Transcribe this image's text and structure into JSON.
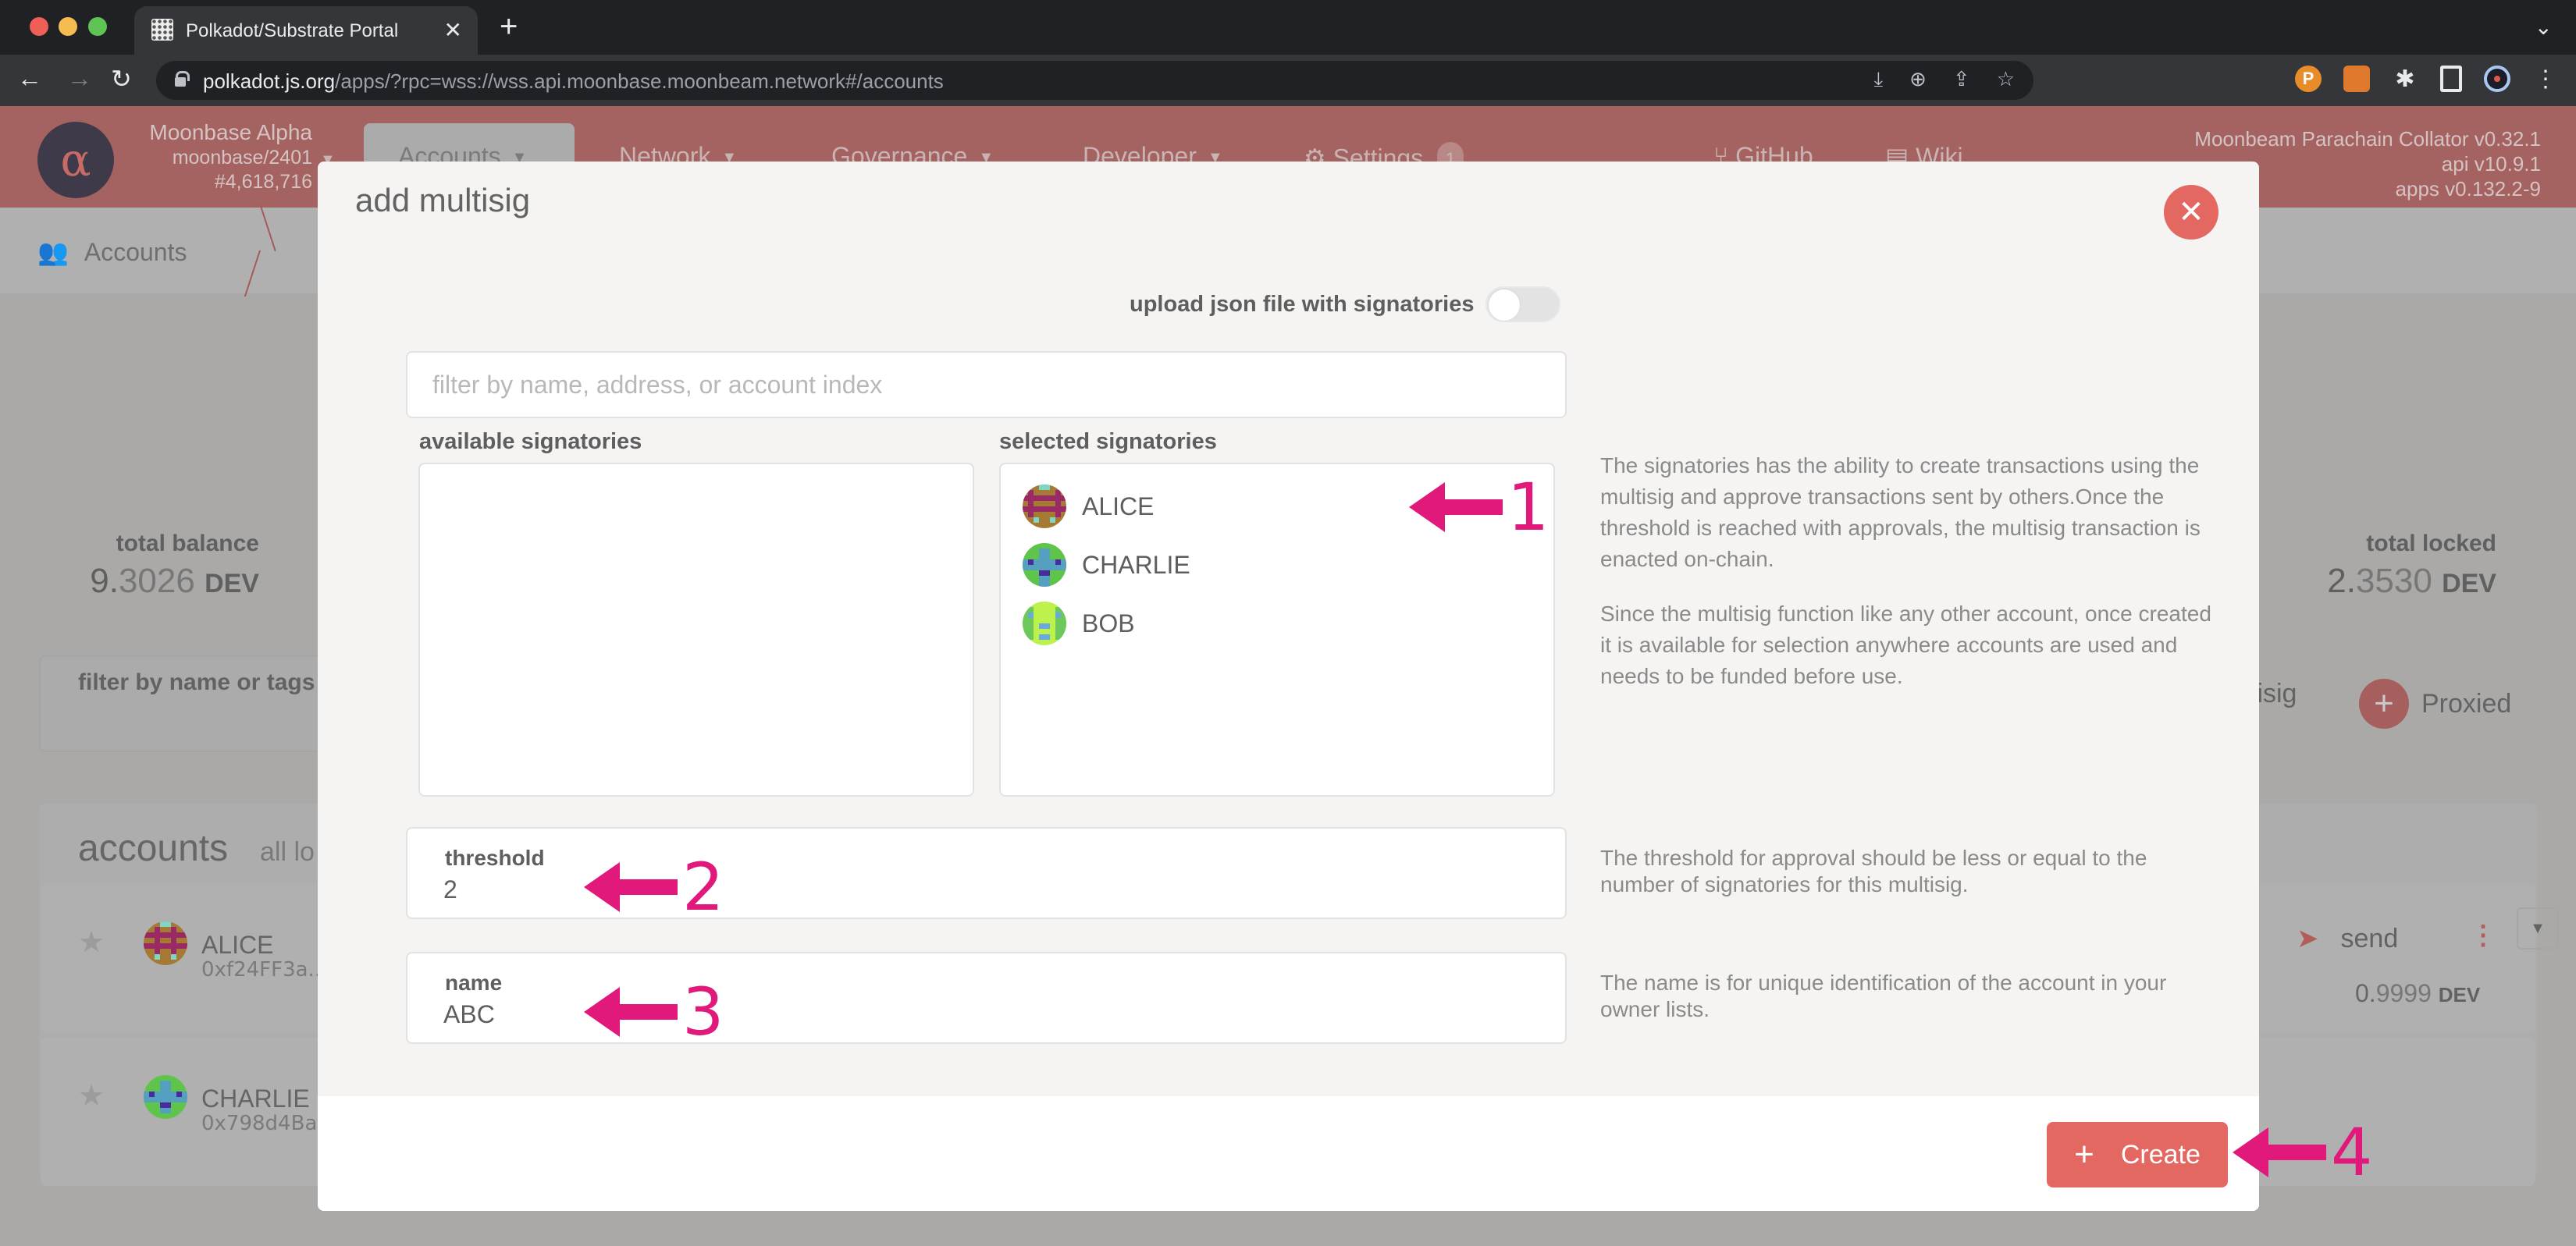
{
  "browser": {
    "tab_title": "Polkadot/Substrate Portal",
    "url_host": "polkadot.js.org",
    "url_path": "/apps/?rpc=wss://wss.api.moonbase.moonbeam.network#/accounts",
    "icons": {
      "back": "arrow-left-icon",
      "forward": "arrow-right-icon",
      "reload": "reload-icon",
      "lock": "lock-icon",
      "omnibox": [
        "download-blocked-icon",
        "zoom-icon",
        "share-icon",
        "bookmark-star-icon"
      ],
      "extensions": [
        "polkadot-extension-icon",
        "metamask-fox-icon",
        "puzzle-extensions-icon",
        "side-panel-icon",
        "profile-avatar-icon",
        "kebab-menu-icon"
      ]
    }
  },
  "header": {
    "chain_name": "Moonbase Alpha",
    "chain_spec": "moonbase/2401",
    "best_block": "#4,618,716",
    "menu": [
      {
        "label": "Accounts",
        "has_dropdown": true,
        "active": true
      },
      {
        "label": "Network",
        "has_dropdown": true
      },
      {
        "label": "Governance",
        "has_dropdown": true
      },
      {
        "label": "Developer",
        "has_dropdown": true
      },
      {
        "label": "Settings",
        "badge": "1",
        "icon": "gear-icon"
      },
      {
        "label": "GitHub",
        "icon": "github-fork-icon"
      },
      {
        "label": "Wiki",
        "icon": "book-icon"
      }
    ],
    "version": {
      "node": "Moonbeam Parachain Collator v0.32.1",
      "api": "api v10.9.1",
      "apps": "apps v0.132.2-9"
    }
  },
  "background": {
    "breadcrumb": "Accounts",
    "total_balance": {
      "label": "total balance",
      "int": "9.",
      "frac": "3026",
      "unit": "DEV"
    },
    "total_locked": {
      "label": "total locked",
      "int": "2.",
      "frac": "3530",
      "unit": "DEV"
    },
    "filter_label": "filter by name or tags",
    "actions": {
      "multisig_partial": "tisig",
      "proxied": "Proxied"
    },
    "accounts_title": "accounts",
    "accounts_subtitle": "all lo",
    "accounts": [
      {
        "name": "ALICE",
        "address": "0xf24FF3a...",
        "send_label": "send",
        "balance_int": "0.",
        "balance_frac": "9999",
        "unit": "DEV"
      },
      {
        "name": "CHARLIE",
        "address": "0x798d4Ba..."
      }
    ]
  },
  "modal": {
    "title": "add multisig",
    "upload_label": "upload json file with signatories",
    "upload_toggle_on": false,
    "filter_placeholder": "filter by name, address, or account index",
    "filter_value": "",
    "available_label": "available signatories",
    "available": [],
    "selected_label": "selected signatories",
    "selected": [
      {
        "name": "ALICE",
        "colors": [
          "#a67a34",
          "#9a2a66",
          "#7fd6c4"
        ]
      },
      {
        "name": "CHARLIE",
        "colors": [
          "#5fc44a",
          "#55a0c0",
          "#4a2a9e"
        ]
      },
      {
        "name": "BOB",
        "colors": [
          "#bdf24c",
          "#6cc85a",
          "#6aa8e0"
        ]
      }
    ],
    "help_signatories": [
      "The signatories has the ability to create transactions using the multisig and approve transactions sent by others.Once the threshold is reached with approvals, the multisig transaction is enacted on-chain.",
      "Since the multisig function like any other account, once created it is available for selection anywhere accounts are used and needs to be funded before use."
    ],
    "threshold_label": "threshold",
    "threshold_value": "2",
    "threshold_help": "The threshold for approval should be less or equal to the number of signatories for this multisig.",
    "name_label": "name",
    "name_value": "ABC",
    "name_help": "The name is for unique identification of the account in your owner lists.",
    "create_label": "Create"
  },
  "annotations": [
    "1",
    "2",
    "3",
    "4"
  ],
  "colors": {
    "accent": "#e36862",
    "annotation": "#e0197a",
    "header_dimmed": "#a46361"
  }
}
